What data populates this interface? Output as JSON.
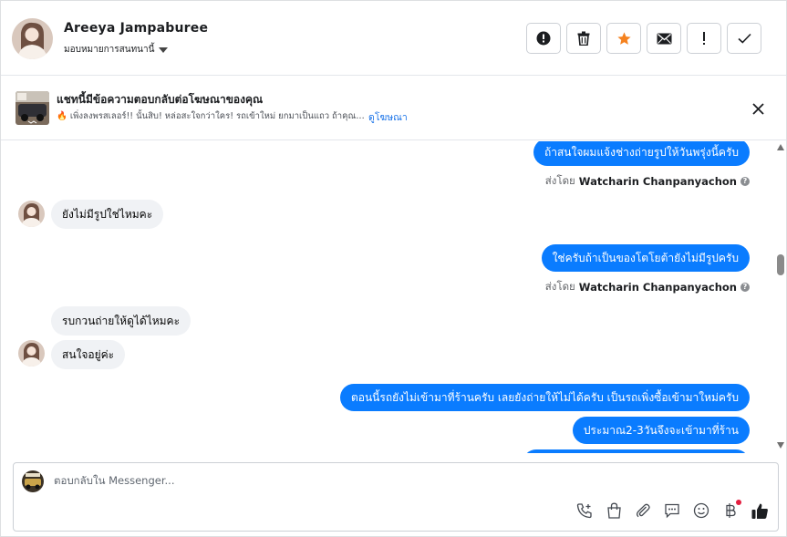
{
  "header": {
    "contact_name": "Areeya Jampaburee",
    "assign_label": "มอบหมายการสนทนานี้",
    "actions": [
      {
        "name": "report-spam-button",
        "icon": "alert-circle-icon"
      },
      {
        "name": "delete-button",
        "icon": "trash-icon"
      },
      {
        "name": "star-button",
        "icon": "star-icon"
      },
      {
        "name": "mark-unread-button",
        "icon": "envelope-icon"
      },
      {
        "name": "follow-up-button",
        "icon": "exclamation-icon"
      },
      {
        "name": "mark-done-button",
        "icon": "check-icon"
      }
    ]
  },
  "ad_banner": {
    "title": "แชทนี้มีข้อความตอบกลับต่อโฆษณาของคุณ",
    "preview": "🔥 เพิ่งลงพรสเลอร์!! นั้นสิบ! หล่อสะใจกว่าใคร! รถเข้าใหม่ ยกมาเป็นแถว ถ้าคุณ…",
    "link": "ดูโฆษณา"
  },
  "messages": {
    "m1": "ถ้าสนใจผมแจ้งช่างถ่ายรูปให้วันพรุ่งนี้ครับ",
    "sent_by_prefix": "ส่งโดย",
    "sender": "Watcharin Chanpanyachon",
    "m2": "ยังไม่มีรูปใช่ไหมคะ",
    "m3": "ใช่ครับถ้าเป็นของโตโยต้ายังไม่มีรูปครับ",
    "m4": "รบกวนถ่ายให้ดูได้ไหมคะ",
    "m5": "สนใจอยู่ค่ะ",
    "m6": "ตอนนี้รถยังไม่เข้ามาที่ร้านครับ เลยยังถ่ายให้ไม่ได้ครับ เป็นรถเพิ่งซื้อเข้ามาใหม่ครับ",
    "m7": "ประมาณ2-3วันจึงจะเข้ามาที่ร้าน"
  },
  "composer": {
    "placeholder": "ตอบกลับใน Messenger...",
    "tools": [
      "call-plus-icon",
      "shopping-bag-icon",
      "paperclip-icon",
      "saved-reply-icon",
      "emoji-icon",
      "baht-icon",
      "thumbs-up-icon"
    ]
  },
  "colors": {
    "outgoing_bubble": "#0a7cff",
    "incoming_bubble": "#f0f2f5",
    "star": "#f5821f",
    "link": "#1a73e8",
    "notification_dot": "#e41e3f"
  }
}
